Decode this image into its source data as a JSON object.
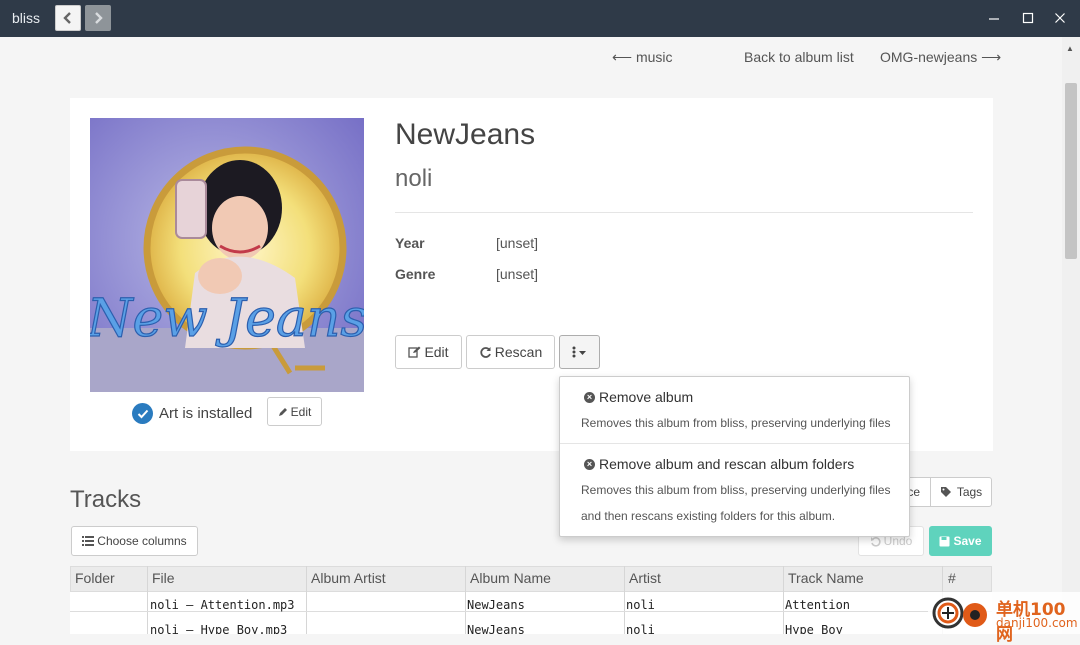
{
  "app": {
    "name": "bliss"
  },
  "nav": {
    "prev": "⟵ music",
    "back": "Back to album list",
    "next": "OMG-newjeans ⟶"
  },
  "album": {
    "title": "NewJeans",
    "artist": "noli",
    "cover_text": "New Jeans",
    "year_label": "Year",
    "year_value": "[unset]",
    "genre_label": "Genre",
    "genre_value": "[unset]",
    "art_status": "Art is installed",
    "art_edit_label": "Edit"
  },
  "actions": {
    "edit_label": "Edit",
    "rescan_label": "Rescan"
  },
  "dropdown": {
    "items": [
      {
        "title": "Remove album",
        "desc": "Removes this album from bliss, preserving underlying files",
        "desc2": ""
      },
      {
        "title": "Remove album and rescan album folders",
        "desc": "Removes this album from bliss, preserving underlying files",
        "desc2": "and then rescans existing folders for this album."
      }
    ]
  },
  "tracks": {
    "heading": "Tracks",
    "choose_columns_label": "Choose columns",
    "tab_partial": "ce",
    "tags_label": "Tags",
    "undo_label": "Undo",
    "save_label": "Save",
    "columns": [
      "Folder",
      "File",
      "Album Artist",
      "Album Name",
      "Artist",
      "Track Name",
      "#"
    ],
    "rows": [
      {
        "folder": "",
        "file": "noli – Attention.mp3",
        "album_artist": "",
        "album_name": "NewJeans",
        "artist": "noli",
        "track_name": "Attention",
        "num": ""
      },
      {
        "folder": "",
        "file": "noli – Hype Boy.mp3",
        "album_artist": "",
        "album_name": "NewJeans",
        "artist": "noli",
        "track_name": "Hype Boy",
        "num": ""
      }
    ]
  },
  "watermark": {
    "title": "单机100网",
    "url": "danji100.com"
  },
  "colors": {
    "titlebar": "#2f3a48",
    "accent": "#2a7bbf",
    "save": "#5fd3bd"
  }
}
